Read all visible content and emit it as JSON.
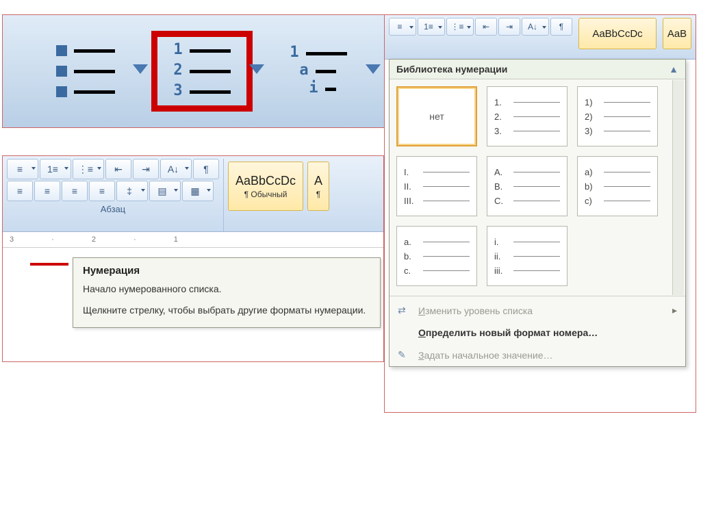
{
  "big_ribbon": {},
  "word": {
    "group_label": "Абзац",
    "ruler_marks": "3 · 2 · 1",
    "style_sample": "AaBbCcDc",
    "style_name": "¶ Обычный",
    "style_name2": "¶"
  },
  "tooltip": {
    "title": "Нумерация",
    "line1": "Начало нумерованного списка.",
    "line2": "Щелкните стрелку, чтобы выбрать другие форматы нумерации."
  },
  "numlib": {
    "mini_style": "AaBbCcDc",
    "mini_style2": "AaB",
    "header": "Библиотека нумерации",
    "none_label": "нет",
    "thumbs": [
      [
        "1.",
        "2.",
        "3."
      ],
      [
        "1)",
        "2)",
        "3)"
      ],
      [
        "I.",
        "II.",
        "III."
      ],
      [
        "A.",
        "B.",
        "C."
      ],
      [
        "a)",
        "b)",
        "c)"
      ],
      [
        "a.",
        "b.",
        "c."
      ],
      [
        "i.",
        "ii.",
        "iii."
      ]
    ],
    "menu": {
      "change_level": "Изменить уровень списка",
      "define_new": "Определить новый формат номера…",
      "set_start": "Задать начальное значение…"
    }
  }
}
